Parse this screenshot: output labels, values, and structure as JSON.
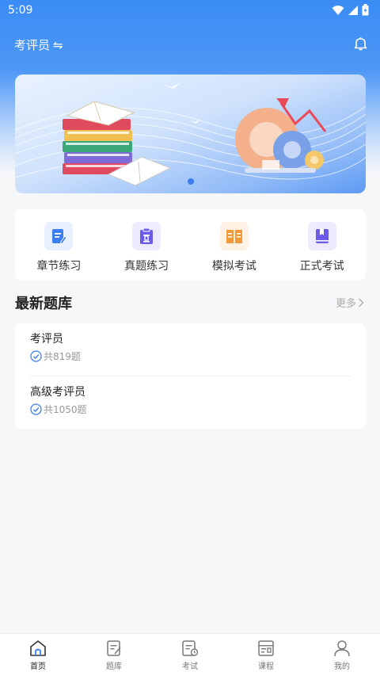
{
  "status_bar": {
    "time": "5:09"
  },
  "header": {
    "role": "考评员",
    "swap_glyph": "⇋",
    "bell_icon": "bell-icon"
  },
  "banner": {
    "slides": 1,
    "active_index": 0
  },
  "quick_actions": [
    {
      "label": "章节练习",
      "icon": "edit-document-icon",
      "color": "#3a7ef0",
      "bg": "#e8efff"
    },
    {
      "label": "真题练习",
      "icon": "clipboard-icon",
      "color": "#6a5ce8",
      "bg": "#eeeaff"
    },
    {
      "label": "模拟考试",
      "icon": "open-book-icon",
      "color": "#f09a3a",
      "bg": "#fff1e3"
    },
    {
      "label": "正式考试",
      "icon": "bookmark-book-icon",
      "color": "#6a5ce8",
      "bg": "#eeeaff"
    }
  ],
  "latest": {
    "title": "最新题库",
    "more": "更多",
    "items": [
      {
        "name": "考评员",
        "count": "共819题"
      },
      {
        "name": "高级考评员",
        "count": "共1050题"
      }
    ]
  },
  "tabs": [
    {
      "label": "首页",
      "icon": "home-icon",
      "active": true
    },
    {
      "label": "题库",
      "icon": "question-bank-icon",
      "active": false
    },
    {
      "label": "考试",
      "icon": "exam-icon",
      "active": false
    },
    {
      "label": "课程",
      "icon": "course-icon",
      "active": false
    },
    {
      "label": "我的",
      "icon": "profile-icon",
      "active": false
    }
  ],
  "colors": {
    "primary": "#3a7ef0",
    "header_blue": "#3a8cf5"
  }
}
